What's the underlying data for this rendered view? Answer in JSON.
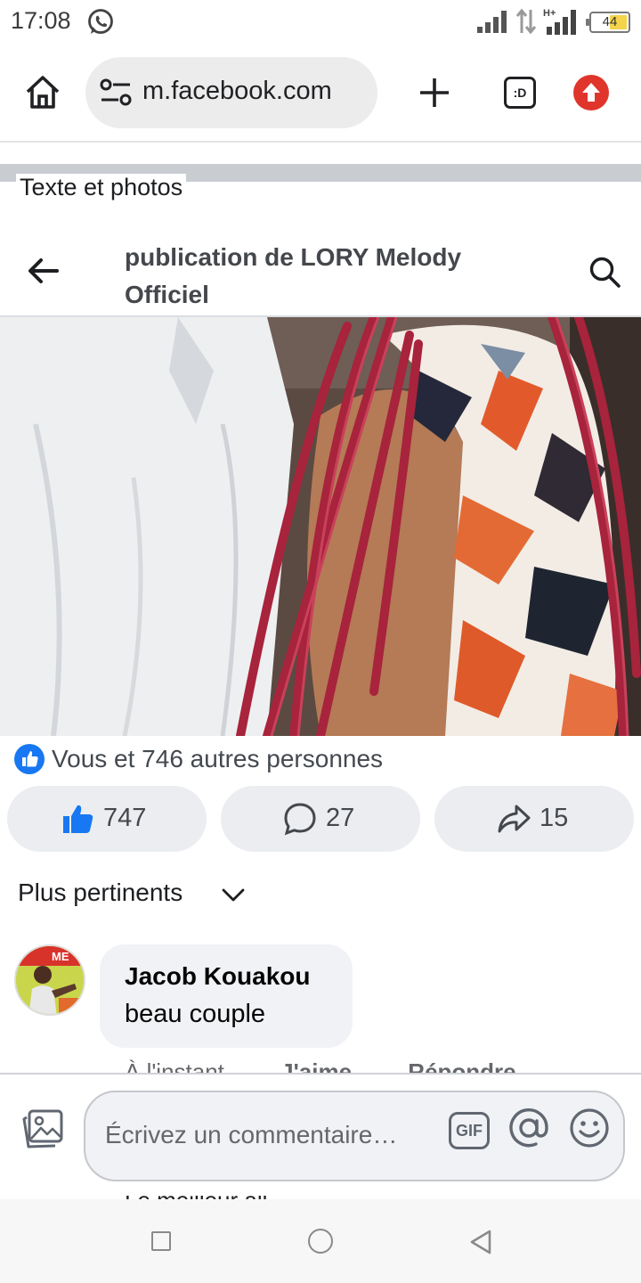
{
  "status_bar": {
    "time": "17:08",
    "battery": "44"
  },
  "browser": {
    "url": "m.facebook.com",
    "tab_indicator": ":D"
  },
  "previous_section_label": "Texte et photos",
  "header": {
    "title": "publication de LORY Melody Officiel"
  },
  "reactions": {
    "summary": "Vous et 746 autres personnes",
    "likes": "747",
    "comments": "27",
    "shares": "15"
  },
  "comments": {
    "sort_label": "Plus pertinents",
    "items": [
      {
        "author": "Jacob Kouakou",
        "text": "beau couple",
        "time": "À l'instant",
        "like_label": "J'aime",
        "reply_label": "Répondre"
      }
    ],
    "next_comment_preview": "Le meilleur all"
  },
  "composer": {
    "placeholder": "Écrivez un commentaire…",
    "gif_label": "GIF"
  },
  "colors": {
    "facebook_blue": "#1877f2",
    "bubble_bg": "#f0f2f5",
    "button_bg": "#ebedf0",
    "update_red": "#e0352b"
  },
  "icons": [
    "whatsapp-icon",
    "signal-icon",
    "data-arrows-icon",
    "battery-icon",
    "home-icon",
    "site-settings-icon",
    "new-tab-icon",
    "tab-switcher-icon",
    "update-icon",
    "back-arrow-icon",
    "search-icon",
    "like-icon",
    "comment-icon",
    "share-icon",
    "chevron-down-icon",
    "photo-icon",
    "gif-icon",
    "mention-icon",
    "emoji-icon"
  ]
}
